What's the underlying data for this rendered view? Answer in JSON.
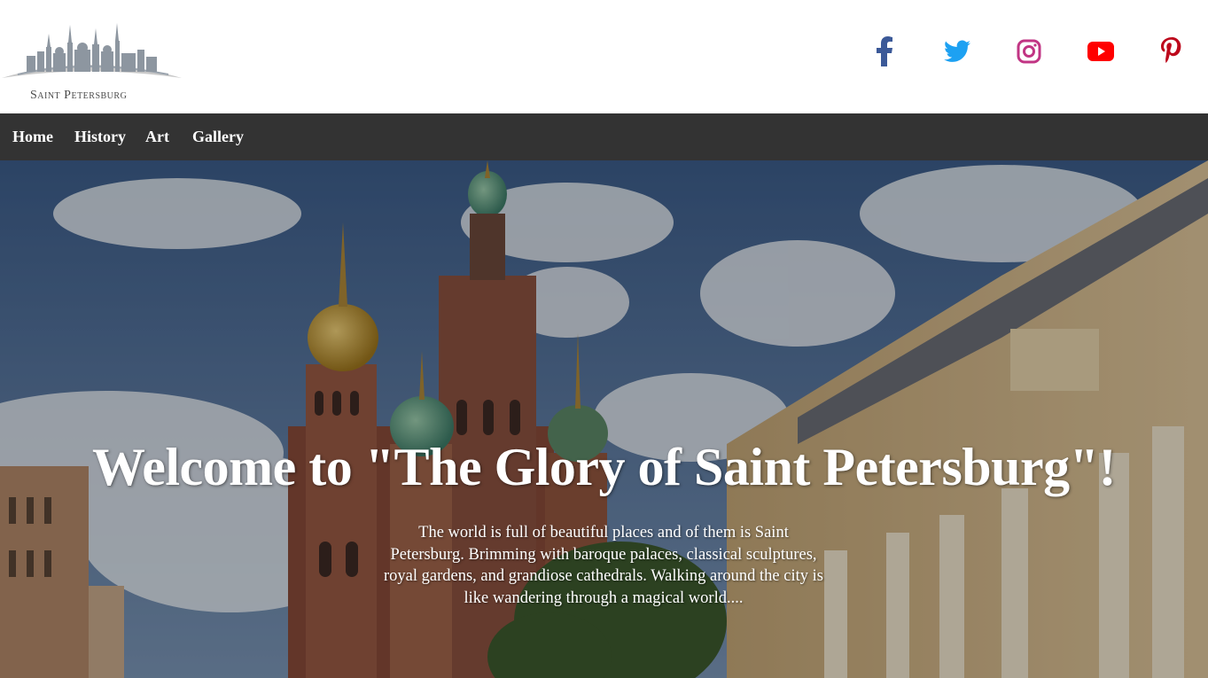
{
  "brand": {
    "logo_text": "Saint Petersburg"
  },
  "social": [
    {
      "name": "facebook-icon",
      "color": "#3b5998"
    },
    {
      "name": "twitter-icon",
      "color": "#1da1f2"
    },
    {
      "name": "instagram-icon",
      "color": "#c13584"
    },
    {
      "name": "youtube-icon",
      "color": "#ff0000"
    },
    {
      "name": "pinterest-icon",
      "color": "#bd081c"
    }
  ],
  "nav": {
    "home": "Home",
    "history": "History",
    "art": "Art",
    "gallery": "Gallery"
  },
  "hero": {
    "title": "Welcome to \"The Glory of Saint Petersburg\"!",
    "text": "The world is full of beautiful places and of them is Saint Petersburg. Brimming with baroque palaces, classical sculptures, royal gardens, and grandiose cathedrals. Walking around the city is like wandering through a magical world...."
  },
  "colors": {
    "nav_bg": "#333333",
    "header_bg": "#ffffff",
    "text_light": "#ffffff"
  }
}
